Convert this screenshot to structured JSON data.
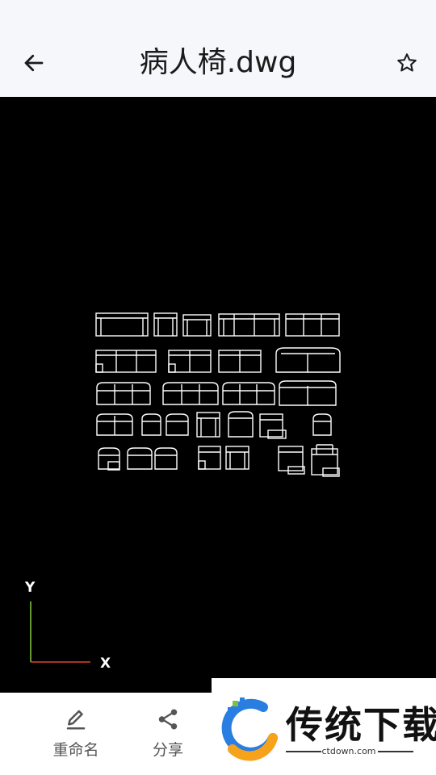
{
  "header": {
    "title": "病人椅.dwg",
    "back_icon": "arrow-left-icon",
    "favorite_icon": "star-outline-icon"
  },
  "viewer": {
    "background": "#000000",
    "stroke_color": "#ffffff",
    "axis": {
      "y_label": "Y",
      "x_label": "X",
      "y_color": "#7cc242",
      "x_color": "#e0452a"
    }
  },
  "toolbar": {
    "rename_label": "重命名",
    "rename_icon": "pencil-icon",
    "share_label": "分享",
    "share_icon": "share-icon"
  },
  "watermark": {
    "brand_text": "传统下载",
    "brand_url": "ctdown.com"
  }
}
